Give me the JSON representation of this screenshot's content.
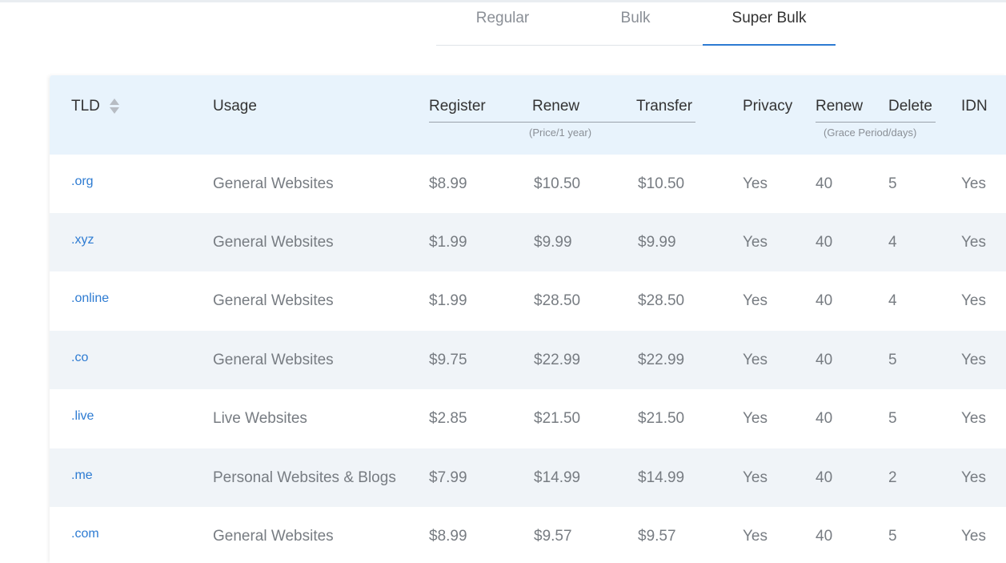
{
  "tabs": [
    {
      "label": "Regular",
      "active": false
    },
    {
      "label": "Bulk",
      "active": false
    },
    {
      "label": "Super Bulk",
      "active": true
    }
  ],
  "accent_color": "#2d7bd2",
  "table": {
    "headers": {
      "tld": "TLD",
      "usage": "Usage",
      "register": "Register",
      "renew": "Renew",
      "transfer": "Transfer",
      "privacy": "Privacy",
      "grace_renew": "Renew",
      "grace_delete": "Delete",
      "idn": "IDN"
    },
    "price_note": "(Price/1 year)",
    "grace_note": "(Grace Period/days)",
    "sort_icon": "sort-updown-icon",
    "rows": [
      {
        "tld": ".org",
        "usage": "General Websites",
        "register": "$8.99",
        "renew": "$10.50",
        "transfer": "$10.50",
        "privacy": "Yes",
        "grace_renew": "40",
        "grace_delete": "5",
        "idn": "Yes"
      },
      {
        "tld": ".xyz",
        "usage": "General Websites",
        "register": "$1.99",
        "renew": "$9.99",
        "transfer": "$9.99",
        "privacy": "Yes",
        "grace_renew": "40",
        "grace_delete": "4",
        "idn": "Yes"
      },
      {
        "tld": ".online",
        "usage": "General Websites",
        "register": "$1.99",
        "renew": "$28.50",
        "transfer": "$28.50",
        "privacy": "Yes",
        "grace_renew": "40",
        "grace_delete": "4",
        "idn": "Yes"
      },
      {
        "tld": ".co",
        "usage": "General Websites",
        "register": "$9.75",
        "renew": "$22.99",
        "transfer": "$22.99",
        "privacy": "Yes",
        "grace_renew": "40",
        "grace_delete": "5",
        "idn": "Yes"
      },
      {
        "tld": ".live",
        "usage": "Live Websites",
        "register": "$2.85",
        "renew": "$21.50",
        "transfer": "$21.50",
        "privacy": "Yes",
        "grace_renew": "40",
        "grace_delete": "5",
        "idn": "Yes"
      },
      {
        "tld": ".me",
        "usage": "Personal Websites & Blogs",
        "register": "$7.99",
        "renew": "$14.99",
        "transfer": "$14.99",
        "privacy": "Yes",
        "grace_renew": "40",
        "grace_delete": "2",
        "idn": "Yes"
      },
      {
        "tld": ".com",
        "usage": "General Websites",
        "register": "$8.99",
        "renew": "$9.57",
        "transfer": "$9.57",
        "privacy": "Yes",
        "grace_renew": "40",
        "grace_delete": "5",
        "idn": "Yes"
      }
    ]
  }
}
